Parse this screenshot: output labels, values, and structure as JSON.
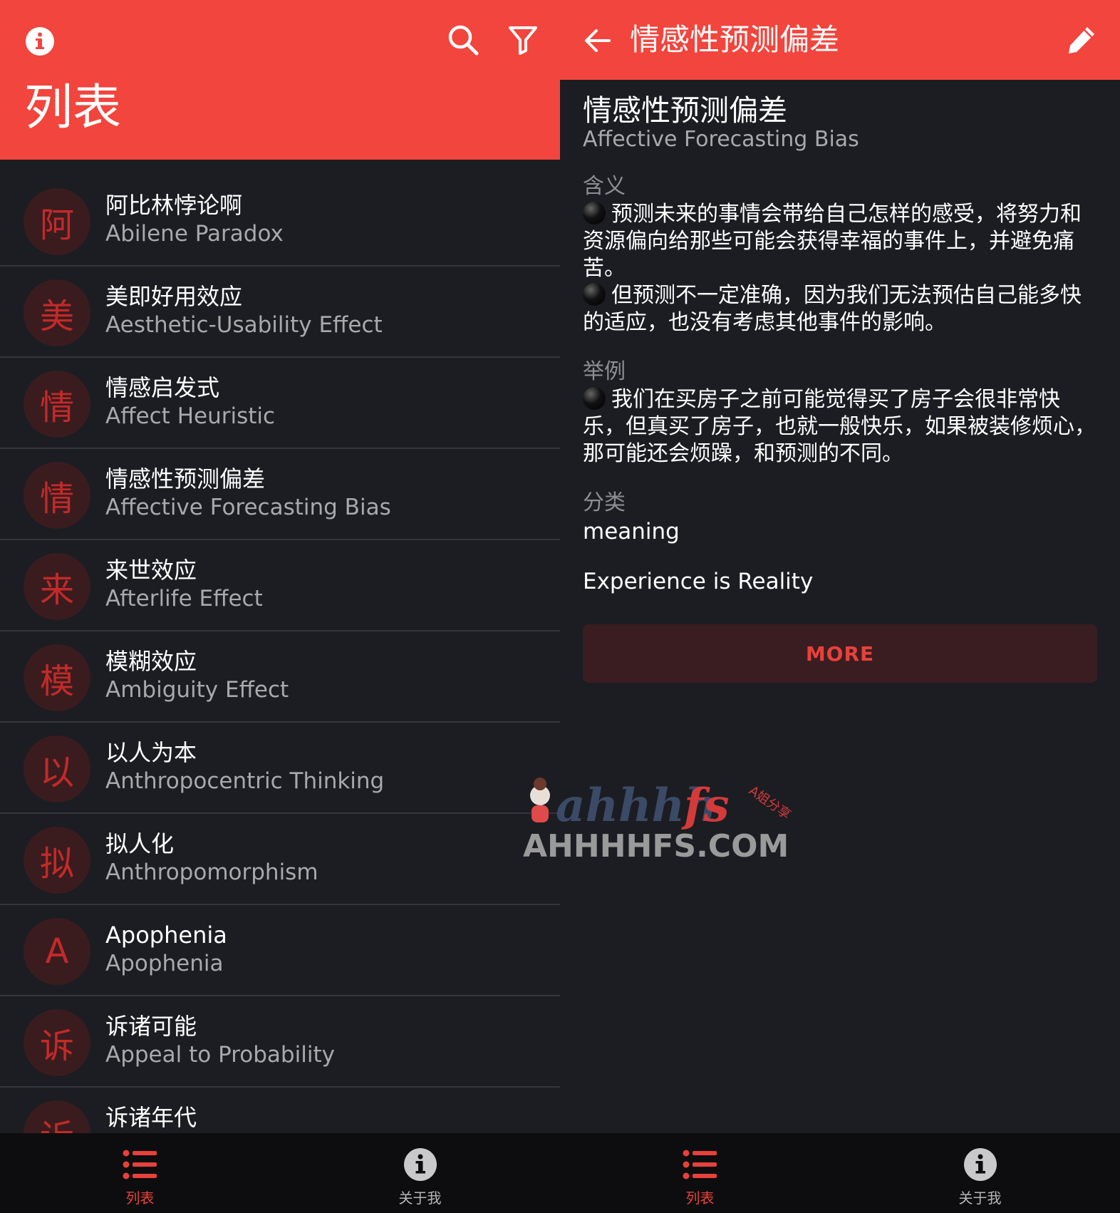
{
  "left": {
    "header": {
      "title": "列表",
      "info_icon": "info-circle-icon",
      "search_icon": "search-icon",
      "filter_icon": "filter-icon",
      "background": "#f2453d"
    },
    "items": [
      {
        "avatar": "阿",
        "title": "阿比林悖论啊",
        "subtitle": "Abilene Paradox"
      },
      {
        "avatar": "美",
        "title": "美即好用效应",
        "subtitle": "Aesthetic-Usability Effect"
      },
      {
        "avatar": "情",
        "title": "情感启发式",
        "subtitle": "Affect Heuristic"
      },
      {
        "avatar": "情",
        "title": "情感性预测偏差",
        "subtitle": "Affective Forecasting Bias"
      },
      {
        "avatar": "来",
        "title": "来世效应",
        "subtitle": "Afterlife Effect"
      },
      {
        "avatar": "模",
        "title": "模糊效应",
        "subtitle": "Ambiguity Effect"
      },
      {
        "avatar": "以",
        "title": "以人为本",
        "subtitle": "Anthropocentric Thinking"
      },
      {
        "avatar": "拟",
        "title": "拟人化",
        "subtitle": "Anthropomorphism"
      },
      {
        "avatar": "A",
        "title": "Apophenia",
        "subtitle": "Apophenia"
      },
      {
        "avatar": "诉",
        "title": "诉诸可能",
        "subtitle": "Appeal to Probability"
      },
      {
        "avatar": "诉",
        "title": "诉诸年代",
        "subtitle": ""
      }
    ],
    "nav": [
      {
        "label": "列表",
        "icon": "list-icon",
        "active": true
      },
      {
        "label": "关于我",
        "icon": "info-circle-icon",
        "active": false
      }
    ]
  },
  "right": {
    "header": {
      "title": "情感性预测偏差",
      "back_icon": "arrow-left-icon",
      "edit_icon": "pencil-icon"
    },
    "detail": {
      "title": "情感性预测偏差",
      "subtitle": "Affective Forecasting Bias",
      "meaning_label": "含义",
      "meaning": [
        "预测未来的事情会带给自己怎样的感受，将努力和资源偏向给那些可能会获得幸福的事件上，并避免痛苦。",
        "但预测不一定准确，因为我们无法预估自己能多快的适应，也没有考虑其他事件的影响。"
      ],
      "example_label": "举例",
      "example": [
        "我们在买房子之前可能觉得买了房子会很非常快乐，但真买了房子，也就一般快乐，如果被装修烦心，那可能还会烦躁，和预测的不同。"
      ],
      "category_label": "分类",
      "category": "meaning",
      "tagline": "Experience is Reality",
      "more_button": "MORE"
    },
    "nav": [
      {
        "label": "列表",
        "icon": "list-icon",
        "active": true
      },
      {
        "label": "关于我",
        "icon": "info-circle-icon",
        "active": false
      }
    ]
  },
  "watermark": {
    "logo_text": "ahhhhfs",
    "site": "AHHHHFS.COM",
    "small": "A姐分享"
  },
  "colors": {
    "accent": "#f2453d",
    "background": "#1b1d22",
    "avatar_bg": "#3a1c1f",
    "avatar_fg": "#c32a28",
    "nav_active": "#e8413a",
    "secondary_text": "#a8a9ad"
  }
}
